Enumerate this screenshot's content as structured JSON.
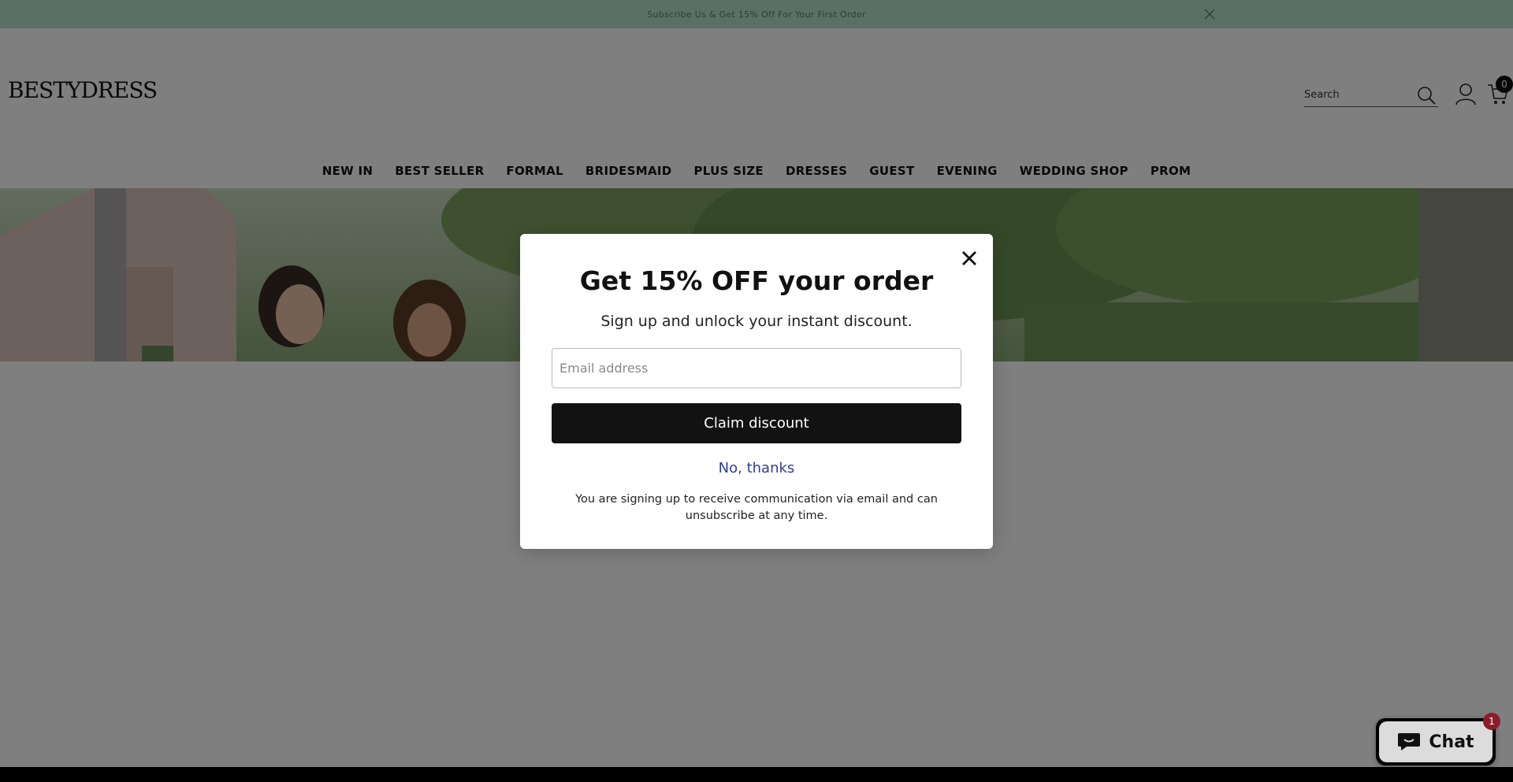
{
  "announcement": {
    "text": "Subscribe Us & Get 15% Off For Your First Order",
    "close_icon": "close-icon"
  },
  "header": {
    "logo": "BESTYDRESS",
    "search": {
      "placeholder": "Search",
      "value": ""
    },
    "cart_count": "0",
    "icons": [
      "search-icon",
      "user-icon",
      "cart-icon"
    ]
  },
  "nav": {
    "items": [
      {
        "label": "NEW IN"
      },
      {
        "label": "BEST SELLER"
      },
      {
        "label": "FORMAL"
      },
      {
        "label": "BRIDESMAID"
      },
      {
        "label": "PLUS SIZE"
      },
      {
        "label": "DRESSES"
      },
      {
        "label": "GUEST"
      },
      {
        "label": "EVENING"
      },
      {
        "label": "WEDDING SHOP"
      },
      {
        "label": "PROM"
      }
    ]
  },
  "modal": {
    "title": "Get 15% OFF your order",
    "subtitle": "Sign up and unlock your instant discount.",
    "email": {
      "placeholder": "Email address",
      "value": ""
    },
    "claim_label": "Claim discount",
    "no_thanks_label": "No, thanks",
    "fine_print": "You are signing up to receive communication via email and can unsubscribe at any time."
  },
  "chat": {
    "label": "Chat",
    "badge": "1"
  },
  "colors": {
    "announcement_bg": "#b5e0cc",
    "claim_button_bg": "#121212",
    "no_thanks_link": "#2d3f94",
    "chat_badge": "#8c1c2c",
    "overlay": "rgba(0,0,0,0.5)"
  }
}
